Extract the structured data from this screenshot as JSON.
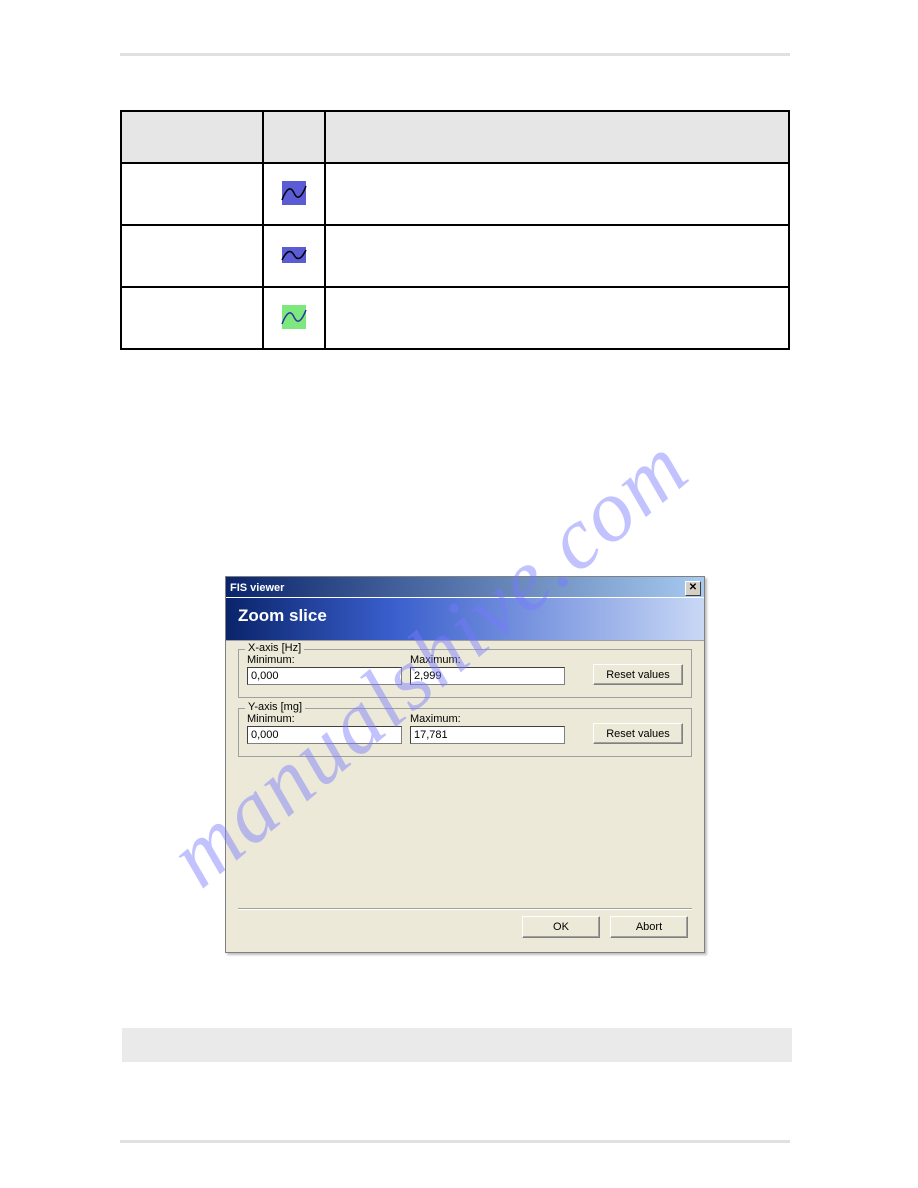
{
  "watermark_text": "manualshive.com",
  "table": {
    "header": [
      "",
      "",
      ""
    ],
    "rows": [
      {
        "icon": "wave-blue"
      },
      {
        "icon": "wave-small"
      },
      {
        "icon": "wave-green"
      }
    ]
  },
  "dialog": {
    "title": "FIS viewer",
    "subtitle": "Zoom slice",
    "x_axis": {
      "legend": "X-axis [Hz]",
      "min_label": "Minimum:",
      "max_label": "Maximum:",
      "min_value": "0,000",
      "max_value": "2,999",
      "reset_label": "Reset values"
    },
    "y_axis": {
      "legend": "Y-axis [mg]",
      "min_label": "Minimum:",
      "max_label": "Maximum:",
      "min_value": "0,000",
      "max_value": "17,781",
      "reset_label": "Reset values"
    },
    "ok_label": "OK",
    "abort_label": "Abort"
  }
}
